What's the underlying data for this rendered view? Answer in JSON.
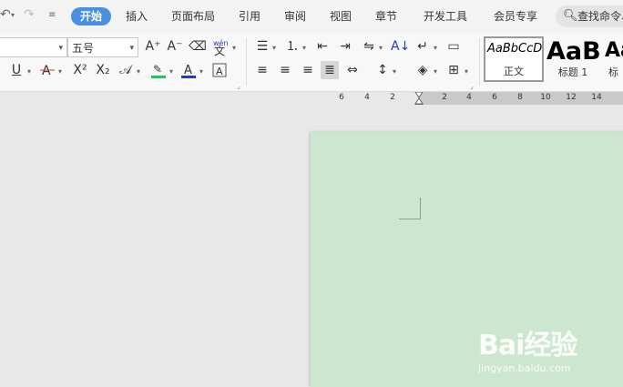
{
  "tabs": [
    {
      "label": "开始",
      "active": true
    },
    {
      "label": "插入",
      "active": false
    },
    {
      "label": "页面布局",
      "active": false
    },
    {
      "label": "引用",
      "active": false
    },
    {
      "label": "审阅",
      "active": false
    },
    {
      "label": "视图",
      "active": false
    },
    {
      "label": "章节",
      "active": false
    },
    {
      "label": "开发工具",
      "active": false
    },
    {
      "label": "会员专享",
      "active": false
    }
  ],
  "search": {
    "placeholder": "查找命令、"
  },
  "font": {
    "size_value": "五号"
  },
  "style_gallery": [
    {
      "sample": "AaBbCcD",
      "name": "正文"
    },
    {
      "sample": "AaB",
      "name": "标题 1"
    },
    {
      "sample": "Aa",
      "name": "标"
    }
  ],
  "ruler": {
    "labels": [
      "6",
      "4",
      "2",
      "2",
      "4",
      "6",
      "8",
      "10",
      "12",
      "14"
    ]
  },
  "watermark": {
    "logo": "Bai经验",
    "url": "jingyan.baidu.com"
  },
  "colors": {
    "accent": "#4a90e2",
    "page_background": "#cde6cf",
    "highlight_green": "#22c55e",
    "font_color_blue": "#1f3cc2"
  }
}
